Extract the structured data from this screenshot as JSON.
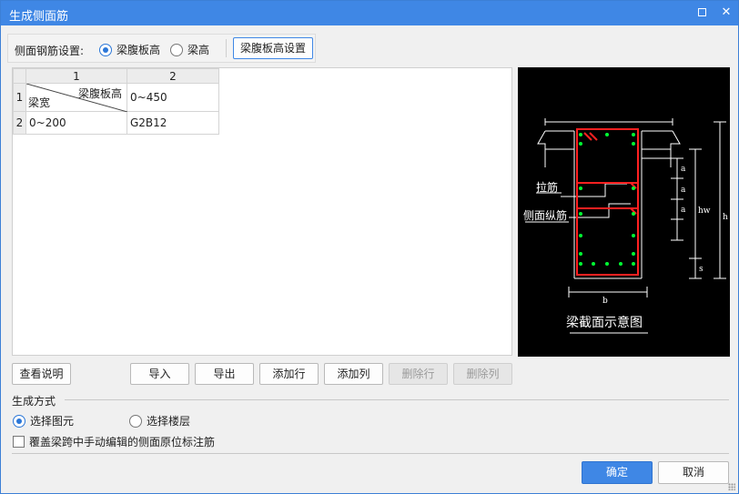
{
  "window": {
    "title": "生成侧面筋"
  },
  "toolbar": {
    "label": "侧面钢筋设置:",
    "radio_web_height": "梁腹板高",
    "radio_beam_height": "梁高",
    "settings_button": "梁腹板高设置"
  },
  "grid": {
    "columns": [
      "1",
      "2"
    ],
    "header_diag_top": "梁腹板高",
    "header_diag_bottom": "梁宽",
    "rows": [
      {
        "num": "1",
        "col2": "0~450"
      },
      {
        "num": "2",
        "col1": "0~200",
        "col2": "G2B12"
      }
    ]
  },
  "diagram": {
    "label_tie": "拉筋",
    "label_side": "侧面纵筋",
    "label_a": "a",
    "label_hw": "hw",
    "label_h": "h",
    "label_s": "s",
    "label_b": "b",
    "caption": "梁截面示意图",
    "colors": {
      "stirrup": "#ff2020",
      "rebar": "#00ff33",
      "line": "#ffffff"
    }
  },
  "actions": {
    "help": "查看说明",
    "import": "导入",
    "export": "导出",
    "add_row": "添加行",
    "add_column": "添加列",
    "delete_row": "删除行",
    "delete_column": "删除列"
  },
  "mode": {
    "section_label": "生成方式",
    "select_element": "选择图元",
    "select_floor": "选择楼层",
    "override_checkbox": "覆盖梁跨中手动编辑的侧面原位标注筋"
  },
  "footer": {
    "ok": "确定",
    "cancel": "取消"
  },
  "colors": {
    "accent": "#3f87e5"
  }
}
